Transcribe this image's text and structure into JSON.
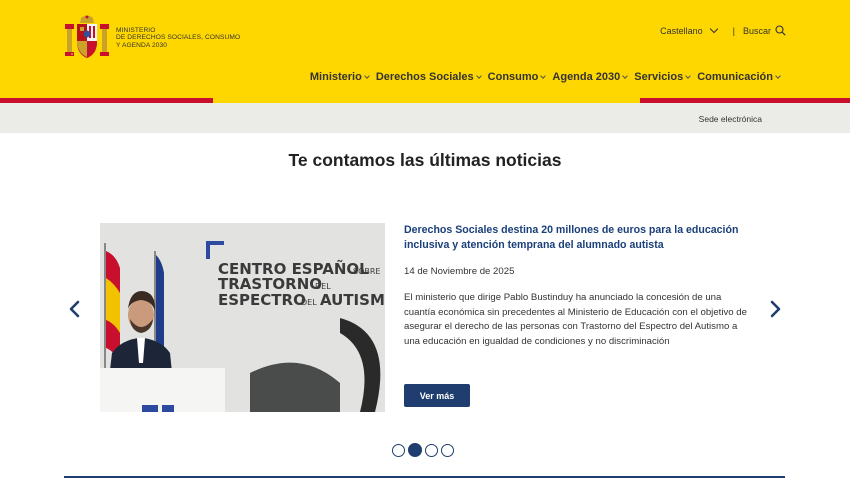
{
  "header": {
    "ministry_lines": [
      "Ministerio",
      "de Derechos Sociales, Consumo",
      "y Agenda 2030"
    ],
    "language": "Castellano",
    "separator": "|",
    "search_label": "Buscar",
    "nav": [
      {
        "label": "Ministerio"
      },
      {
        "label": "Derechos Sociales"
      },
      {
        "label": "Consumo"
      },
      {
        "label": "Agenda 2030"
      },
      {
        "label": "Servicios"
      },
      {
        "label": "Comunicación"
      }
    ],
    "sede_label": "Sede electrónica"
  },
  "section": {
    "title": "Te contamos las últimas noticias"
  },
  "news": {
    "title": "Derechos Sociales destina 20 millones de euros para la educación inclusiva y atención temprana del alumnado autista",
    "date": "14 de Noviembre de 2025",
    "description": "El ministerio que dirige Pablo Bustinduy ha anunciado la concesión de una cuantía económica sin precedentes al Ministerio de Educación con el objetivo de asegurar el derecho de las personas con Trastorno del Espectro del Autismo a una educación en igualdad de condiciones y no discriminación",
    "button_label": "Ver más",
    "image_sign": {
      "line1": "CENTRO ESPAÑOL",
      "line1_small": "SOBRE",
      "line2": "TRASTORNO",
      "line2_small": "DEL",
      "line3": "ESPECTRO",
      "line3_small": "DEL",
      "line3_end": "AUTISMO"
    }
  },
  "carousel": {
    "slide_count": 4,
    "active_index": 1
  },
  "colors": {
    "header_yellow": "#ffd700",
    "accent_red": "#c8102e",
    "navy": "#1f3d6e",
    "link_blue": "#1a3f7a",
    "subbar_gray": "#ebebe8"
  }
}
